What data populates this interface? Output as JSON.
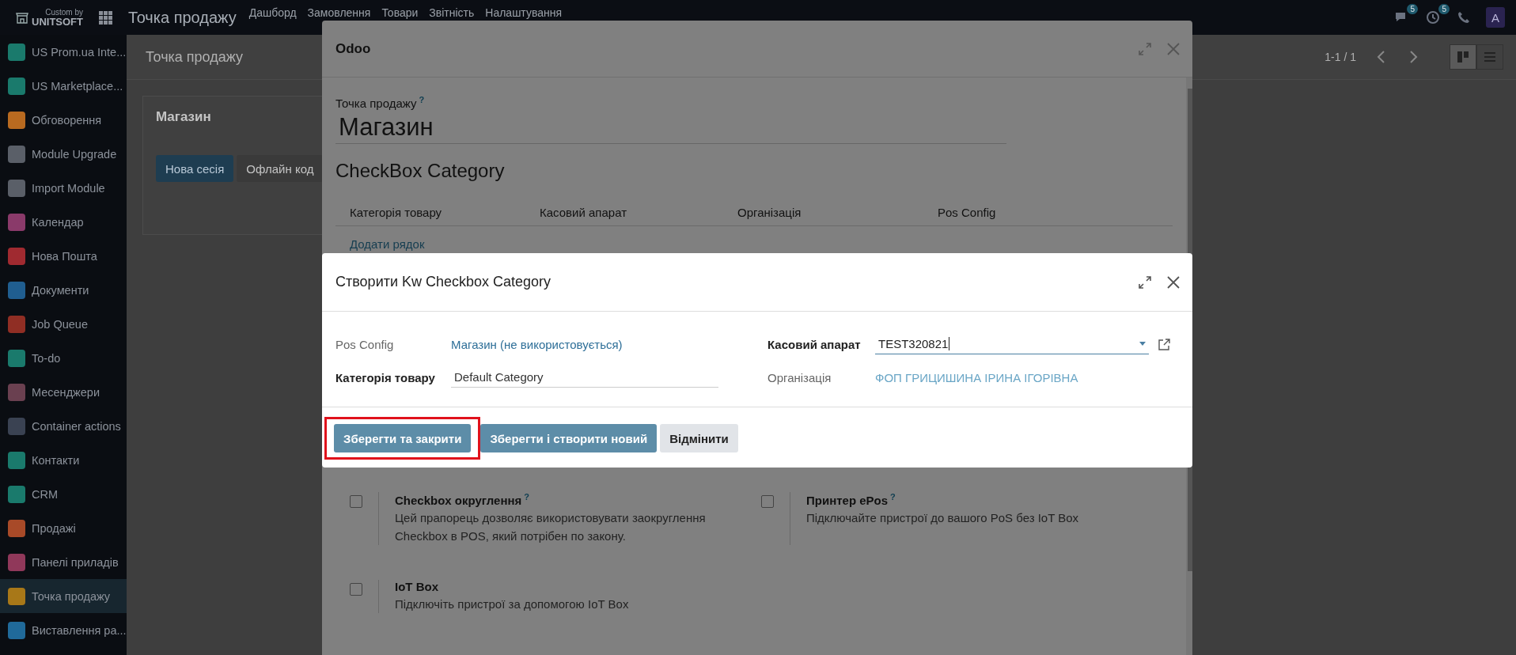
{
  "navbar": {
    "brand_small": "Custom by",
    "brand": "UNITSOFT",
    "app_title": "Точка продажу",
    "menu": [
      "Дашборд",
      "Замовлення",
      "Товари",
      "Звітність",
      "Налаштування"
    ],
    "chat_count": "5",
    "activity_count": "5",
    "avatar": "A"
  },
  "sidebar": {
    "items": [
      {
        "label": "US Prom.ua Inte...",
        "color": "#1a7a6c",
        "selected": false
      },
      {
        "label": "US Marketplace...",
        "color": "#1a7a6c",
        "selected": false
      },
      {
        "label": "Обговорення",
        "color": "#b86a20",
        "selected": false
      },
      {
        "label": "Module Upgrade",
        "color": "#5a5f68",
        "selected": false
      },
      {
        "label": "Import Module",
        "color": "#5a5f68",
        "selected": false
      },
      {
        "label": "Календар",
        "color": "#8a3a6a",
        "selected": false
      },
      {
        "label": "Нова Пошта",
        "color": "#a02a30",
        "selected": false
      },
      {
        "label": "Документи",
        "color": "#205e90",
        "selected": false
      },
      {
        "label": "Job Queue",
        "color": "#902e24",
        "selected": false
      },
      {
        "label": "To-do",
        "color": "#1a7a6c",
        "selected": false
      },
      {
        "label": "Месенджери",
        "color": "#6a4050",
        "selected": false
      },
      {
        "label": "Container actions",
        "color": "#3a4252",
        "selected": false
      },
      {
        "label": "Контакти",
        "color": "#1a7a6c",
        "selected": false
      },
      {
        "label": "CRM",
        "color": "#1a7a6c",
        "selected": false
      },
      {
        "label": "Продажі",
        "color": "#a84a28",
        "selected": false
      },
      {
        "label": "Панелі приладів",
        "color": "#90385a",
        "selected": false
      },
      {
        "label": "Точка продажу",
        "color": "#a87818",
        "selected": true
      },
      {
        "label": "Виставлення ра...",
        "color": "#206a9a",
        "selected": false
      }
    ]
  },
  "control_panel": {
    "title": "Точка продажу",
    "pager": "1-1 / 1"
  },
  "kanban_card": {
    "title": "Магазин",
    "buttons": [
      {
        "label": "Нова сесія",
        "kind": "primary"
      },
      {
        "label": "Офлайн код",
        "kind": "secondary"
      }
    ]
  },
  "form_dialog": {
    "title": "Odoo",
    "name_label": "Точка продажу",
    "help_mark": "?",
    "name": "Магазин",
    "section_title": "CheckBox Category",
    "table": {
      "columns": [
        "Категорія товару",
        "Касовий апарат",
        "Організація",
        "Pos Config"
      ],
      "add_line": "Додати рядок"
    },
    "settings": [
      {
        "title": "Checkbox округлення",
        "help_mark": "?",
        "description": "Цей прапорець дозволяє використовувати заокруглення Checkbox в POS, який потрібен по закону.",
        "checked": false
      },
      {
        "title": "Принтер ePos",
        "help_mark": "?",
        "description": "Підключайте пристрої до вашого PoS без IoT Box",
        "checked": false
      },
      {
        "title": "IoT Box",
        "description": "Підключіть пристрої за допомогою IoT Box",
        "checked": false
      }
    ]
  },
  "create_dialog": {
    "title": "Створити Kw Checkbox Category",
    "fields": [
      {
        "kind": "link",
        "label": "Pos Config",
        "value": "Магазин (не використовується)"
      },
      {
        "kind": "select",
        "label": "Касовий апарат",
        "value": "TEST320821"
      },
      {
        "kind": "input",
        "label": "Категорія товару",
        "value": "Default Category"
      },
      {
        "kind": "readonly",
        "label": "Організація",
        "value": "ФОП ГРИЦИШИНА ІРИНА ІГОРІВНА"
      }
    ],
    "buttons": [
      {
        "label": "Зберегти та закрити",
        "kind": "primary",
        "highlighted": true
      },
      {
        "label": "Зберегти і створити новий",
        "kind": "primary",
        "highlighted": false
      },
      {
        "label": "Відмінити",
        "kind": "secondary",
        "highlighted": false
      }
    ]
  }
}
